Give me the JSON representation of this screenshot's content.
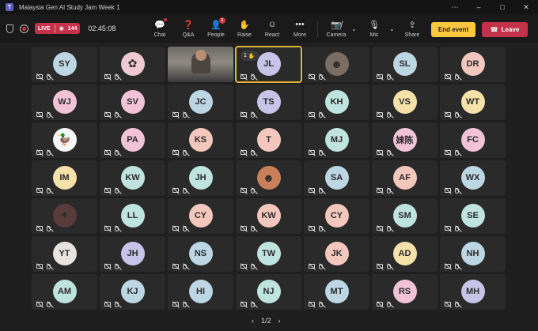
{
  "window": {
    "title": "Malaysia Gen AI Study Jam Week 1",
    "controls": [
      "⋯",
      "–",
      "□",
      "✕"
    ]
  },
  "meeting": {
    "live_label": "LIVE",
    "viewer_count": "144",
    "timer": "02:45:08"
  },
  "toolbar": {
    "chat_label": "Chat",
    "qa_label": "Q&A",
    "people_label": "People",
    "people_badge": "1",
    "raise_label": "Raise",
    "react_label": "React",
    "more_label": "More",
    "camera_label": "Camera",
    "mic_label": "Mic",
    "share_label": "Share",
    "end_label": "End event",
    "leave_label": "Leave"
  },
  "colors": {
    "accent_end": "#ffc83d",
    "accent_leave": "#c4314b",
    "active_speaker": "#e0b33a"
  },
  "participants": [
    {
      "initials": "SY",
      "bg": "#bcd6e4"
    },
    {
      "initials": "",
      "bg": "#f0c9d2",
      "image": "flower-avatar"
    },
    {
      "initials": "",
      "bg": "",
      "image": "live-video"
    },
    {
      "initials": "JL",
      "bg": "#c8c3e8",
      "hand": "1",
      "active": true
    },
    {
      "initials": "",
      "bg": "#7a6d63",
      "image": "photo-avatar"
    },
    {
      "initials": "SL",
      "bg": "#bcd6e4"
    },
    {
      "initials": "DR",
      "bg": "#f4c7bd"
    },
    {
      "initials": "WJ",
      "bg": "#f2c2d7"
    },
    {
      "initials": "SV",
      "bg": "#f2c2d7"
    },
    {
      "initials": "JC",
      "bg": "#bcd6e4"
    },
    {
      "initials": "TS",
      "bg": "#c8c3e8"
    },
    {
      "initials": "KH",
      "bg": "#bfe3df"
    },
    {
      "initials": "VS",
      "bg": "#f6e2a8"
    },
    {
      "initials": "WT",
      "bg": "#f6e2a8"
    },
    {
      "initials": "",
      "bg": "#f5f5f5",
      "image": "duck-avatar"
    },
    {
      "initials": "PA",
      "bg": "#f2c2d7"
    },
    {
      "initials": "KS",
      "bg": "#f4c7bd"
    },
    {
      "initials": "T",
      "bg": "#f4c7bd"
    },
    {
      "initials": "MJ",
      "bg": "#bfe3df"
    },
    {
      "initials": "婡陈",
      "bg": "#f2c2d7"
    },
    {
      "initials": "FC",
      "bg": "#f2c2d7"
    },
    {
      "initials": "IM",
      "bg": "#f6e2a8"
    },
    {
      "initials": "KW",
      "bg": "#bfe3df"
    },
    {
      "initials": "JH",
      "bg": "#bfe3df"
    },
    {
      "initials": "",
      "bg": "#c9805a",
      "image": "photo-avatar"
    },
    {
      "initials": "SA",
      "bg": "#bcd6e4"
    },
    {
      "initials": "AF",
      "bg": "#f4c7bd"
    },
    {
      "initials": "WX",
      "bg": "#bcd6e4"
    },
    {
      "initials": "",
      "bg": "#5a3b3b",
      "image": "character-avatar"
    },
    {
      "initials": "LL",
      "bg": "#bfe3df"
    },
    {
      "initials": "CY",
      "bg": "#f4c7bd"
    },
    {
      "initials": "KW",
      "bg": "#f4c7bd"
    },
    {
      "initials": "CY",
      "bg": "#f4c7bd"
    },
    {
      "initials": "SM",
      "bg": "#bfe3df"
    },
    {
      "initials": "SE",
      "bg": "#bfe3df"
    },
    {
      "initials": "YT",
      "bg": "#e8e3de"
    },
    {
      "initials": "JH",
      "bg": "#c8c3e8"
    },
    {
      "initials": "NS",
      "bg": "#bcd6e4"
    },
    {
      "initials": "TW",
      "bg": "#bfe3df"
    },
    {
      "initials": "JK",
      "bg": "#f4c7bd"
    },
    {
      "initials": "AD",
      "bg": "#f6e2a8"
    },
    {
      "initials": "NH",
      "bg": "#bcd6e4"
    },
    {
      "initials": "AM",
      "bg": "#bfe3df"
    },
    {
      "initials": "KJ",
      "bg": "#bcd6e4"
    },
    {
      "initials": "HI",
      "bg": "#bcd6e4"
    },
    {
      "initials": "NJ",
      "bg": "#bfe3df"
    },
    {
      "initials": "MT",
      "bg": "#bcd6e4"
    },
    {
      "initials": "RS",
      "bg": "#f2c2d7"
    },
    {
      "initials": "MH",
      "bg": "#c8c3e8"
    }
  ],
  "pager": {
    "text": "1/2",
    "prev_icon": "chevron-left-icon",
    "next_icon": "chevron-right-icon"
  }
}
